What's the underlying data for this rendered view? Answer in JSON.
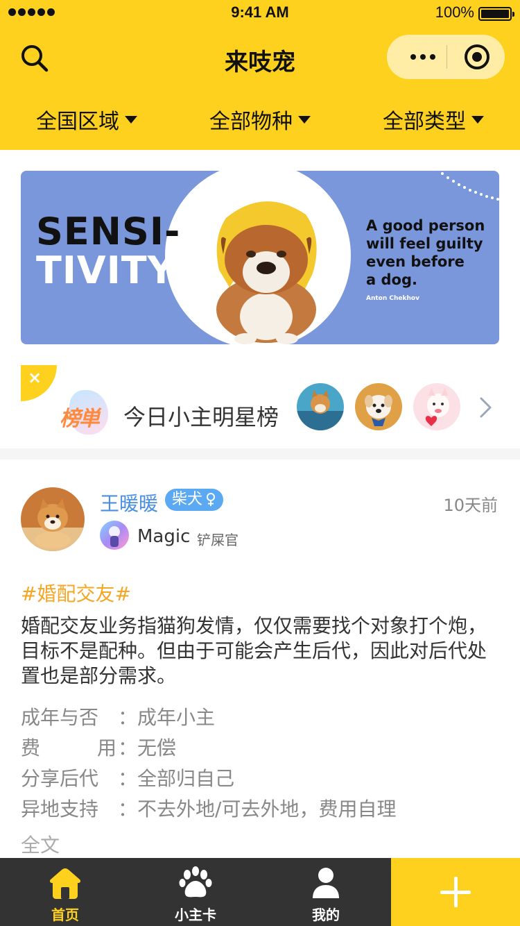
{
  "status_bar": {
    "time": "9:41 AM",
    "battery": "100%"
  },
  "nav": {
    "title": "来吱宠"
  },
  "filters": [
    {
      "label": "全国区域"
    },
    {
      "label": "全部物种"
    },
    {
      "label": "全部类型"
    }
  ],
  "banner": {
    "headline_1": "SENSI-",
    "headline_2": "TIVITY",
    "quote_1": "A good person",
    "quote_2": "will feel guilty",
    "quote_3": "even before",
    "quote_4": "a dog.",
    "author": "Anton Chekhov"
  },
  "star_board": {
    "logo_text": "榜単",
    "title": "今日小主明星榜",
    "close_symbol": "×"
  },
  "post": {
    "pet_name": "王暖暖",
    "breed": "柴犬",
    "time": "10天前",
    "owner_name": "Magic",
    "owner_role": "铲屎官",
    "hashtag": "#婚配交友#",
    "body": "婚配交友业务指猫狗发情，仅仅需要找个对象打个炮，目标不是配种。但由于可能会产生后代，因此对后代处置也是部分需求。",
    "attrs": [
      {
        "k1": "成年与否",
        "k2": "",
        "colon": "：",
        "value": "成年小主"
      },
      {
        "k1": "费",
        "k2": "用",
        "colon": "：",
        "value": "无偿"
      },
      {
        "k1": "分享后代",
        "k2": "",
        "colon": "：",
        "value": "全部归自己"
      },
      {
        "k1": "异地支持",
        "k2": "",
        "colon": "：",
        "value": "不去外地/可去外地，费用自理"
      }
    ],
    "read_more": "全文"
  },
  "tabbar": {
    "items": [
      {
        "label": "首页",
        "icon": "home-icon",
        "active": true
      },
      {
        "label": "小主卡",
        "icon": "paw-icon",
        "active": false
      },
      {
        "label": "我的",
        "icon": "user-icon",
        "active": false
      }
    ],
    "add_icon": "plus-icon"
  },
  "colors": {
    "brand": "#fed11f",
    "tabbar": "#333333",
    "link": "#4a90e2",
    "tag": "#5aa9f2",
    "hashtag": "#f5a623",
    "banner": "#7b97dc"
  }
}
